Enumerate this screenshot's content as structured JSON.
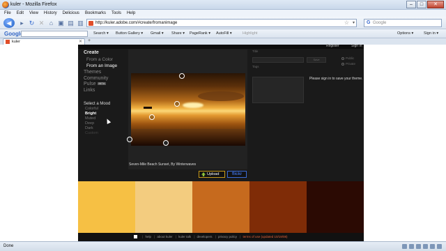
{
  "window": {
    "title": "kuler - Mozilla Firefox",
    "min": "–",
    "max": "□",
    "close": "✕"
  },
  "menu": [
    "File",
    "Edit",
    "View",
    "History",
    "Delicious",
    "Bookmarks",
    "Tools",
    "Help"
  ],
  "nav": {
    "url": "http://kuler.adobe.com/#create/fromanimage",
    "search_placeholder": "Google"
  },
  "google_toolbar": {
    "logo": "Google",
    "items": [
      "Search ▾",
      "Button Gallery ▾",
      "Gmail ▾",
      "Share ▾",
      "PageRank ▾",
      "AutoFill ▾"
    ],
    "dim_item": "Highlight",
    "options": "Options ▾",
    "signin": "Sign in ▾"
  },
  "tab": {
    "label": "kuler",
    "close": "✕",
    "new": "+"
  },
  "kuler": {
    "top": {
      "register": "Register",
      "signin": "Sign In"
    },
    "nav": {
      "create": "Create",
      "from_color": "From a Color",
      "from_image": "From an Image",
      "themes": "Themes",
      "community": "Community",
      "pulse": "Pulse",
      "pulse_badge": "BETA",
      "links": "Links"
    },
    "mood": {
      "title": "Select a Mood",
      "items": [
        "Colorful",
        "Bright",
        "Muted",
        "Deep",
        "Dark",
        "Custom"
      ]
    },
    "caption": "Seven-Mile Beach Sunset, By Winterwaves",
    "upload_label": "Upload",
    "flickr": {
      "a": "flickr",
      "b": ""
    },
    "right": {
      "title_label": "Title",
      "tags_label": "Tags",
      "save_btn": "Save",
      "public_label": "Public",
      "private_label": "Private",
      "message": "Please sign in to save your theme."
    },
    "swatches": [
      "#f6c044",
      "#f3cc7f",
      "#c66a1e",
      "#7f2c07",
      "#2b0a03"
    ],
    "footer": {
      "links": [
        "help",
        "about kuler",
        "kuler talk",
        "developers",
        "privacy policy"
      ],
      "terms": "terms of use (updated 10/19/08)"
    }
  },
  "status": {
    "done": "Done"
  }
}
